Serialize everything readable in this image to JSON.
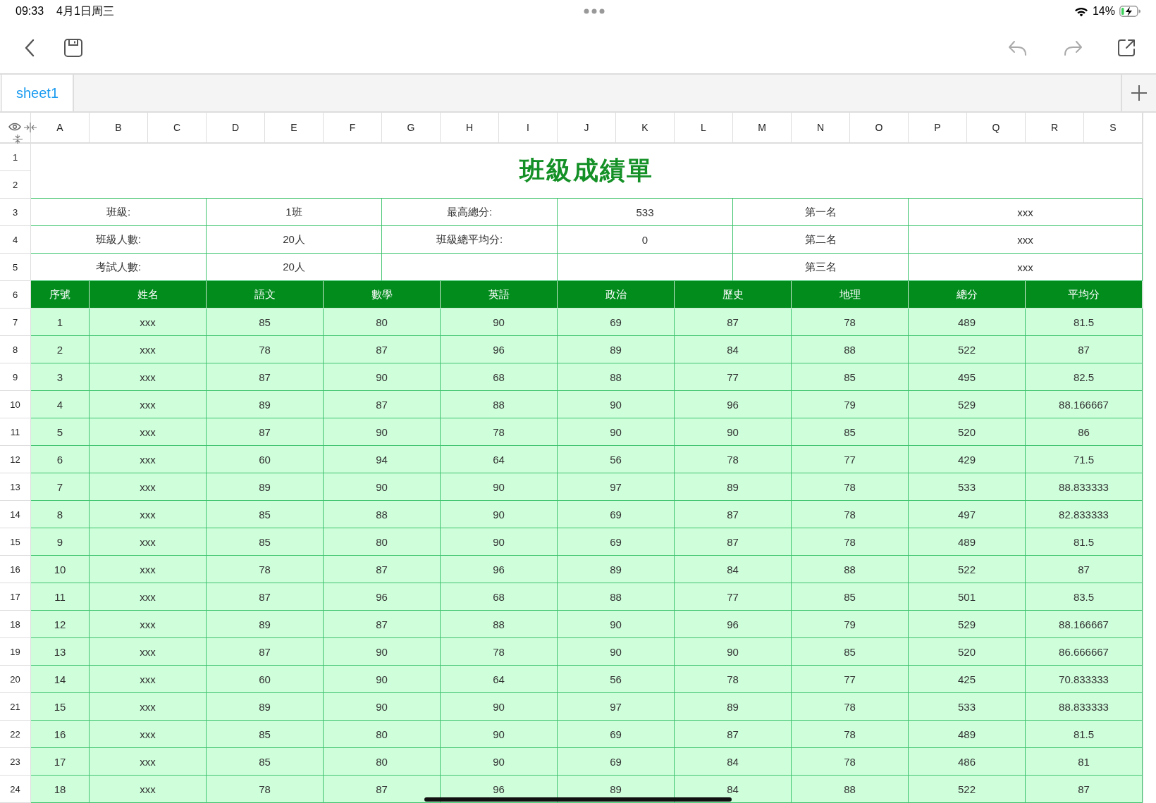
{
  "status_bar": {
    "time": "09:33",
    "date": "4月1日周三",
    "battery": "14%"
  },
  "toolbar": {
    "undo": {
      "disabled": true
    },
    "redo": {
      "disabled": true
    }
  },
  "tabs": [
    {
      "label": "sheet1",
      "selected": true
    }
  ],
  "sheet": {
    "columns": [
      "A",
      "B",
      "C",
      "D",
      "E",
      "F",
      "G",
      "H",
      "I",
      "J",
      "K",
      "L",
      "M",
      "N",
      "O",
      "P",
      "Q",
      "R",
      "S"
    ],
    "row_numbers": [
      "1",
      "2",
      "3",
      "4",
      "5",
      "6",
      "7",
      "8",
      "9",
      "10",
      "11",
      "12",
      "13",
      "14",
      "15",
      "16",
      "17",
      "18",
      "19",
      "20",
      "21",
      "22",
      "23",
      "24"
    ],
    "title": "班級成績單",
    "info_rows": [
      {
        "label_1": "班級:",
        "value_1": "1班",
        "label_2": "最高總分:",
        "value_2": "533",
        "rank": "第一名",
        "name": "xxx"
      },
      {
        "label_1": "班級人數:",
        "value_1": "20人",
        "label_2": "班級總平均分:",
        "value_2": "0",
        "rank": "第二名",
        "name": "xxx"
      },
      {
        "label_1": "考試人數:",
        "value_1": "20人",
        "rank": "第三名",
        "name": "xxx"
      }
    ],
    "headers": [
      "序號",
      "姓名",
      "語文",
      "數學",
      "英語",
      "政治",
      "歷史",
      "地理",
      "總分",
      "平均分"
    ],
    "rows": [
      [
        "1",
        "xxx",
        "85",
        "80",
        "90",
        "69",
        "87",
        "78",
        "489",
        "81.5"
      ],
      [
        "2",
        "xxx",
        "78",
        "87",
        "96",
        "89",
        "84",
        "88",
        "522",
        "87"
      ],
      [
        "3",
        "xxx",
        "87",
        "90",
        "68",
        "88",
        "77",
        "85",
        "495",
        "82.5"
      ],
      [
        "4",
        "xxx",
        "89",
        "87",
        "88",
        "90",
        "96",
        "79",
        "529",
        "88.166667"
      ],
      [
        "5",
        "xxx",
        "87",
        "90",
        "78",
        "90",
        "90",
        "85",
        "520",
        "86"
      ],
      [
        "6",
        "xxx",
        "60",
        "94",
        "64",
        "56",
        "78",
        "77",
        "429",
        "71.5"
      ],
      [
        "7",
        "xxx",
        "89",
        "90",
        "90",
        "97",
        "89",
        "78",
        "533",
        "88.833333"
      ],
      [
        "8",
        "xxx",
        "85",
        "88",
        "90",
        "69",
        "87",
        "78",
        "497",
        "82.833333"
      ],
      [
        "9",
        "xxx",
        "85",
        "80",
        "90",
        "69",
        "87",
        "78",
        "489",
        "81.5"
      ],
      [
        "10",
        "xxx",
        "78",
        "87",
        "96",
        "89",
        "84",
        "88",
        "522",
        "87"
      ],
      [
        "11",
        "xxx",
        "87",
        "96",
        "68",
        "88",
        "77",
        "85",
        "501",
        "83.5"
      ],
      [
        "12",
        "xxx",
        "89",
        "87",
        "88",
        "90",
        "96",
        "79",
        "529",
        "88.166667"
      ],
      [
        "13",
        "xxx",
        "87",
        "90",
        "78",
        "90",
        "90",
        "85",
        "520",
        "86.666667"
      ],
      [
        "14",
        "xxx",
        "60",
        "90",
        "64",
        "56",
        "78",
        "77",
        "425",
        "70.833333"
      ],
      [
        "15",
        "xxx",
        "89",
        "90",
        "90",
        "97",
        "89",
        "78",
        "533",
        "88.833333"
      ],
      [
        "16",
        "xxx",
        "85",
        "80",
        "90",
        "69",
        "87",
        "78",
        "489",
        "81.5"
      ],
      [
        "17",
        "xxx",
        "85",
        "80",
        "90",
        "69",
        "84",
        "78",
        "486",
        "81"
      ],
      [
        "18",
        "xxx",
        "78",
        "87",
        "96",
        "89",
        "84",
        "88",
        "522",
        "87"
      ]
    ]
  }
}
